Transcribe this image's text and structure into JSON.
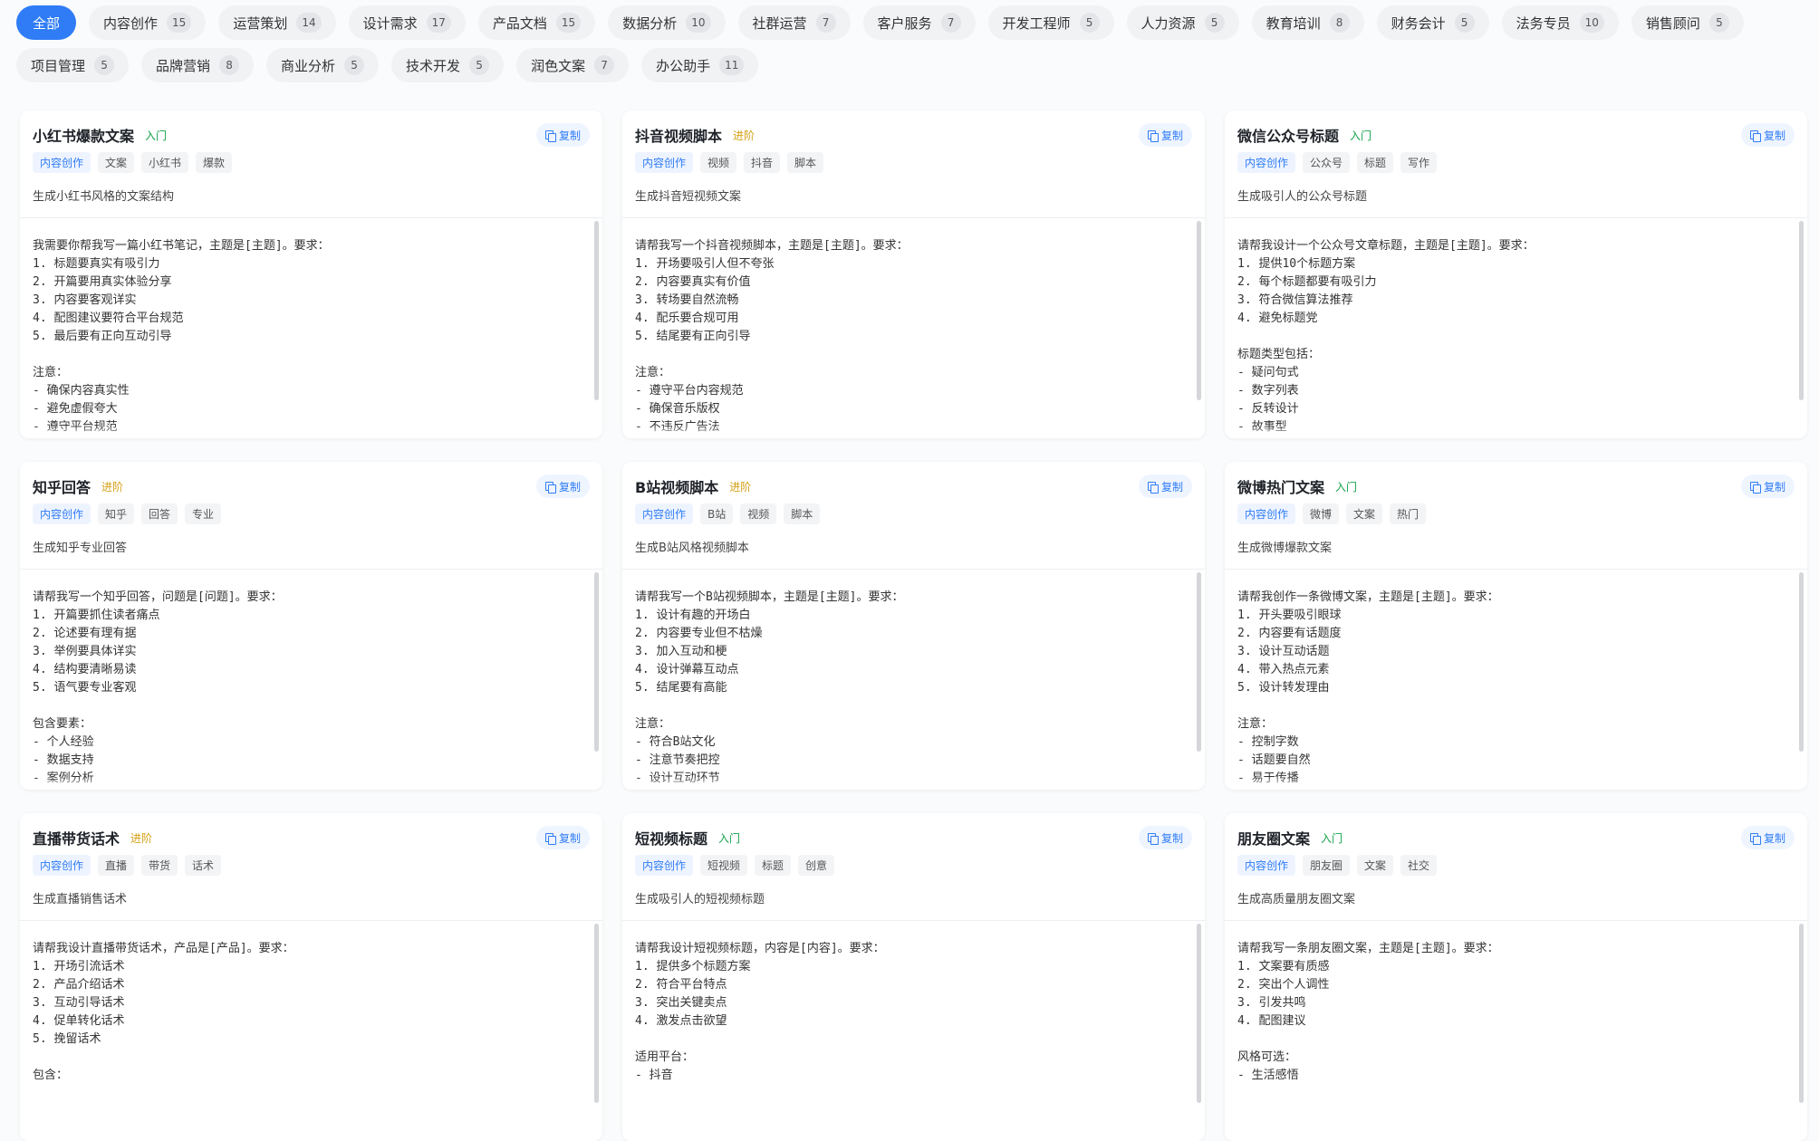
{
  "filters": [
    {
      "label": "全部",
      "count": null,
      "active": true
    },
    {
      "label": "内容创作",
      "count": "15"
    },
    {
      "label": "运营策划",
      "count": "14"
    },
    {
      "label": "设计需求",
      "count": "17"
    },
    {
      "label": "产品文档",
      "count": "15"
    },
    {
      "label": "数据分析",
      "count": "10"
    },
    {
      "label": "社群运营",
      "count": "7"
    },
    {
      "label": "客户服务",
      "count": "7"
    },
    {
      "label": "开发工程师",
      "count": "5"
    },
    {
      "label": "人力资源",
      "count": "5"
    },
    {
      "label": "教育培训",
      "count": "8"
    },
    {
      "label": "财务会计",
      "count": "5"
    },
    {
      "label": "法务专员",
      "count": "10"
    },
    {
      "label": "销售顾问",
      "count": "5"
    },
    {
      "label": "项目管理",
      "count": "5"
    },
    {
      "label": "品牌营销",
      "count": "8"
    },
    {
      "label": "商业分析",
      "count": "5"
    },
    {
      "label": "技术开发",
      "count": "5"
    },
    {
      "label": "润色文案",
      "count": "7"
    },
    {
      "label": "办公助手",
      "count": "11"
    }
  ],
  "copy_label": "复制",
  "colors": {
    "accent": "#2f7cf6",
    "level_basic": "#16a34a",
    "level_advanced": "#d4a017"
  },
  "cards": [
    {
      "title": "小红书爆款文案",
      "level": "入门",
      "level_color": "green",
      "tags": [
        "内容创作",
        "文案",
        "小红书",
        "爆款"
      ],
      "desc": "生成小红书风格的文案结构",
      "prompt": "我需要你帮我写一篇小红书笔记，主题是[主题]。要求：\n1. 标题要真实有吸引力\n2. 开篇要用真实体验分享\n3. 内容要客观详实\n4. 配图建议要符合平台规范\n5. 最后要有正向互动引导\n\n注意：\n- 确保内容真实性\n- 避免虚假夸大\n- 遵守平台规范"
    },
    {
      "title": "抖音视频脚本",
      "level": "进阶",
      "level_color": "yellow",
      "tags": [
        "内容创作",
        "视频",
        "抖音",
        "脚本"
      ],
      "desc": "生成抖音短视频文案",
      "prompt": "请帮我写一个抖音视频脚本，主题是[主题]。要求：\n1. 开场要吸引人但不夸张\n2. 内容要真实有价值\n3. 转场要自然流畅\n4. 配乐要合规可用\n5. 结尾要有正向引导\n\n注意：\n- 遵守平台内容规范\n- 确保音乐版权\n- 不违反广告法"
    },
    {
      "title": "微信公众号标题",
      "level": "入门",
      "level_color": "green",
      "tags": [
        "内容创作",
        "公众号",
        "标题",
        "写作"
      ],
      "desc": "生成吸引人的公众号标题",
      "prompt": "请帮我设计一个公众号文章标题，主题是[主题]。要求：\n1. 提供10个标题方案\n2. 每个标题都要有吸引力\n3. 符合微信算法推荐\n4. 避免标题党\n\n标题类型包括：\n- 疑问句式\n- 数字列表\n- 反转设计\n- 故事型"
    },
    {
      "title": "知乎回答",
      "level": "进阶",
      "level_color": "yellow",
      "tags": [
        "内容创作",
        "知乎",
        "回答",
        "专业"
      ],
      "desc": "生成知乎专业回答",
      "prompt": "请帮我写一个知乎回答，问题是[问题]。要求：\n1. 开篇要抓住读者痛点\n2. 论述要有理有据\n3. 举例要具体详实\n4. 结构要清晰易读\n5. 语气要专业客观\n\n包含要素：\n- 个人经验\n- 数据支持\n- 案例分析"
    },
    {
      "title": "B站视频脚本",
      "level": "进阶",
      "level_color": "yellow",
      "tags": [
        "内容创作",
        "B站",
        "视频",
        "脚本"
      ],
      "desc": "生成B站风格视频脚本",
      "prompt": "请帮我写一个B站视频脚本，主题是[主题]。要求：\n1. 设计有趣的开场白\n2. 内容要专业但不枯燥\n3. 加入互动和梗\n4. 设计弹幕互动点\n5. 结尾要有高能\n\n注意：\n- 符合B站文化\n- 注意节奏把控\n- 设计互动环节"
    },
    {
      "title": "微博热门文案",
      "level": "入门",
      "level_color": "green",
      "tags": [
        "内容创作",
        "微博",
        "文案",
        "热门"
      ],
      "desc": "生成微博爆款文案",
      "prompt": "请帮我创作一条微博文案，主题是[主题]。要求：\n1. 开头要吸引眼球\n2. 内容要有话题度\n3. 设计互动话题\n4. 带入热点元素\n5. 设计转发理由\n\n注意：\n- 控制字数\n- 话题要自然\n- 易于传播"
    },
    {
      "title": "直播带货话术",
      "level": "进阶",
      "level_color": "yellow",
      "tags": [
        "内容创作",
        "直播",
        "带货",
        "话术"
      ],
      "desc": "生成直播销售话术",
      "prompt": "请帮我设计直播带货话术，产品是[产品]。要求：\n1. 开场引流话术\n2. 产品介绍话术\n3. 互动引导话术\n4. 促单转化话术\n5. 挽留话术\n\n包含："
    },
    {
      "title": "短视频标题",
      "level": "入门",
      "level_color": "green",
      "tags": [
        "内容创作",
        "短视频",
        "标题",
        "创意"
      ],
      "desc": "生成吸引人的短视频标题",
      "prompt": "请帮我设计短视频标题，内容是[内容]。要求：\n1. 提供多个标题方案\n2. 符合平台特点\n3. 突出关键卖点\n4. 激发点击欲望\n\n适用平台：\n- 抖音"
    },
    {
      "title": "朋友圈文案",
      "level": "入门",
      "level_color": "green",
      "tags": [
        "内容创作",
        "朋友圈",
        "文案",
        "社交"
      ],
      "desc": "生成高质量朋友圈文案",
      "prompt": "请帮我写一条朋友圈文案，主题是[主题]。要求：\n1. 文案要有质感\n2. 突出个人调性\n3. 引发共鸣\n4. 配图建议\n\n风格可选：\n- 生活感悟"
    }
  ]
}
